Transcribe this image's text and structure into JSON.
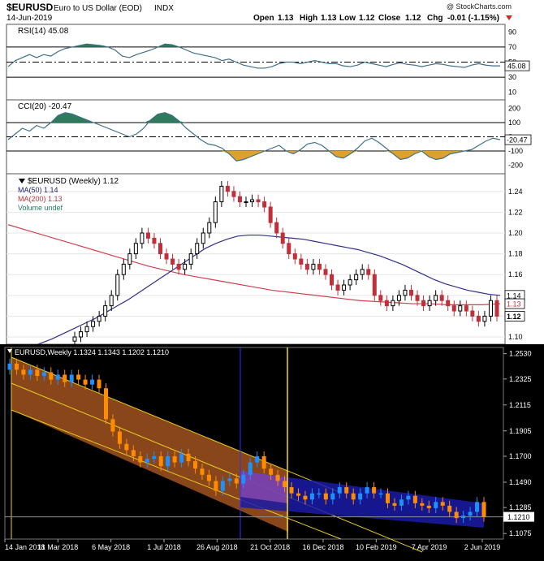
{
  "header": {
    "symbol": "$EURUSD",
    "description": "Euro to US Dollar (EOD)",
    "exchange": "INDX",
    "date": "14-Jun-2019",
    "watermark": "@ StockCharts.com",
    "open_label": "Open",
    "open": "1.13",
    "high_label": "High",
    "high": "1.13",
    "low_label": "Low",
    "low": "1.12",
    "close_label": "Close",
    "close": "1.12",
    "chg_label": "Chg",
    "chg": "-0.01 (-1.15%)",
    "chg_icon": "down-triangle-icon"
  },
  "rsi": {
    "label": "RSI(14) 45.08",
    "ticks": [
      "90",
      "70",
      "50",
      "30",
      "10"
    ],
    "tick_values": [
      90,
      70,
      50,
      30,
      10
    ],
    "ylim": [
      0,
      100
    ],
    "current": "45.08",
    "current_value": 45.08,
    "lines": [
      70,
      30
    ],
    "values": [
      44,
      52,
      56,
      60,
      56,
      60,
      58,
      64,
      68,
      70,
      72,
      74,
      73,
      72,
      70,
      66,
      58,
      56,
      60,
      63,
      66,
      70,
      74,
      73,
      70,
      66,
      62,
      60,
      58,
      56,
      52,
      54,
      50,
      46,
      44,
      42,
      42,
      44,
      48,
      50,
      50,
      48,
      50,
      52,
      50,
      48,
      48,
      45,
      44,
      46,
      50,
      48,
      46,
      44,
      47,
      49,
      47,
      46,
      44,
      46,
      48,
      47,
      45,
      44,
      43,
      46,
      48,
      46,
      45,
      45
    ]
  },
  "cci": {
    "label": "CCI(20) -20.47",
    "ticks": [
      "200",
      "100",
      "0",
      "-100",
      "-200"
    ],
    "tick_values": [
      200,
      100,
      0,
      -100,
      -200
    ],
    "ylim": [
      -260,
      260
    ],
    "current": "-20.47",
    "current_value": -20.47,
    "lines": [
      100,
      -100
    ],
    "values": [
      -20,
      20,
      60,
      40,
      80,
      60,
      100,
      150,
      170,
      160,
      140,
      120,
      100,
      80,
      60,
      40,
      20,
      0,
      20,
      60,
      120,
      160,
      170,
      150,
      110,
      60,
      20,
      -20,
      -50,
      -60,
      -80,
      -120,
      -170,
      -160,
      -140,
      -120,
      -100,
      -80,
      -60,
      -100,
      -120,
      -90,
      -50,
      -40,
      -60,
      -100,
      -140,
      -150,
      -120,
      -80,
      -30,
      -10,
      -40,
      -80,
      -120,
      -160,
      -150,
      -120,
      -100,
      -140,
      -160,
      -150,
      -120,
      -110,
      -100,
      -90,
      -60,
      -30,
      -10,
      -20
    ]
  },
  "price": {
    "label": "$EURUSD (Weekly) 1.12",
    "legend": [
      {
        "label": "MA(50) 1.14",
        "color": "#20207a"
      },
      {
        "label": "MA(200) 1.13",
        "color": "#c0303a"
      },
      {
        "label": "Volume undef",
        "color": "#208060"
      }
    ],
    "ticks": [
      "1.24",
      "1.22",
      "1.20",
      "1.18",
      "1.16",
      "1.14",
      "1.12",
      "1.10"
    ],
    "tick_values": [
      1.24,
      1.22,
      1.2,
      1.18,
      1.16,
      1.14,
      1.12,
      1.1
    ],
    "ylim": [
      1.093,
      1.257
    ],
    "ma50_tag": "1.14",
    "ma50_value": 1.14,
    "ma200_tag": "1.13",
    "ma200_value": 1.132,
    "close_tag": "1.12",
    "close_value": 1.12,
    "closes": [
      1.1,
      1.105,
      1.11,
      1.115,
      1.12,
      1.13,
      1.14,
      1.16,
      1.17,
      1.18,
      1.19,
      1.2,
      1.195,
      1.19,
      1.18,
      1.175,
      1.17,
      1.165,
      1.17,
      1.18,
      1.19,
      1.2,
      1.21,
      1.23,
      1.245,
      1.24,
      1.235,
      1.23,
      1.23,
      1.232,
      1.23,
      1.225,
      1.21,
      1.2,
      1.19,
      1.18,
      1.175,
      1.17,
      1.165,
      1.17,
      1.165,
      1.16,
      1.15,
      1.145,
      1.15,
      1.155,
      1.16,
      1.165,
      1.16,
      1.14,
      1.135,
      1.13,
      1.135,
      1.14,
      1.145,
      1.14,
      1.135,
      1.13,
      1.135,
      1.14,
      1.135,
      1.13,
      1.125,
      1.13,
      1.125,
      1.12,
      1.115,
      1.12,
      1.135,
      1.12
    ],
    "ma50": [
      1.085,
      1.087,
      1.09,
      1.094,
      1.098,
      1.103,
      1.108,
      1.113,
      1.118,
      1.124,
      1.13,
      1.136,
      1.143,
      1.15,
      1.157,
      1.164,
      1.171,
      1.178,
      1.185,
      1.19,
      1.194,
      1.197,
      1.198,
      1.198,
      1.197,
      1.196,
      1.195,
      1.194,
      1.192,
      1.19,
      1.188,
      1.186,
      1.184,
      1.181,
      1.178,
      1.174,
      1.17,
      1.165,
      1.16,
      1.155,
      1.151,
      1.148,
      1.145,
      1.143,
      1.141,
      1.14
    ],
    "ma200": [
      1.208,
      1.203,
      1.198,
      1.193,
      1.188,
      1.183,
      1.178,
      1.173,
      1.168,
      1.164,
      1.16,
      1.157,
      1.154,
      1.151,
      1.148,
      1.145,
      1.143,
      1.141,
      1.139,
      1.137,
      1.135,
      1.134,
      1.133,
      1.132,
      1.132,
      1.131,
      1.131,
      1.131,
      1.132
    ]
  },
  "mt": {
    "label": "EURUSD,Weekly  1.1324 1.1343 1.1202 1.1210",
    "ticks": [
      "1.2530",
      "1.2325",
      "1.2115",
      "1.1905",
      "1.1700",
      "1.1490",
      "1.1285",
      "1.1075"
    ],
    "tick_values": [
      1.253,
      1.2325,
      1.2115,
      1.1905,
      1.17,
      1.149,
      1.1285,
      1.1075
    ],
    "ylim": [
      1.103,
      1.258
    ],
    "current_tag": "1.1210",
    "current_value": 1.121,
    "dates": [
      "14 Jan 2018",
      "11 Mar 2018",
      "6 May 2018",
      "1 Jul 2018",
      "26 Aug 2018",
      "21 Oct 2018",
      "16 Dec 2018",
      "10 Feb 2019",
      "7 Apr 2019",
      "2 Jun 2019"
    ],
    "closes": [
      1.245,
      1.24,
      1.236,
      1.24,
      1.235,
      1.238,
      1.232,
      1.236,
      1.23,
      1.236,
      1.232,
      1.228,
      1.232,
      1.225,
      1.2,
      1.19,
      1.18,
      1.175,
      1.17,
      1.165,
      1.168,
      1.17,
      1.162,
      1.17,
      1.165,
      1.172,
      1.166,
      1.16,
      1.155,
      1.15,
      1.142,
      1.15,
      1.152,
      1.148,
      1.155,
      1.165,
      1.17,
      1.16,
      1.155,
      1.15,
      1.145,
      1.14,
      1.138,
      1.135,
      1.14,
      1.14,
      1.135,
      1.14,
      1.145,
      1.14,
      1.135,
      1.14,
      1.145,
      1.14,
      1.14,
      1.132,
      1.13,
      1.135,
      1.138,
      1.132,
      1.13,
      1.128,
      1.133,
      1.13,
      1.125,
      1.12,
      1.122,
      1.125,
      1.133,
      1.121
    ],
    "up_color": "#1e90ff",
    "down_color": "#ff8c00"
  }
}
